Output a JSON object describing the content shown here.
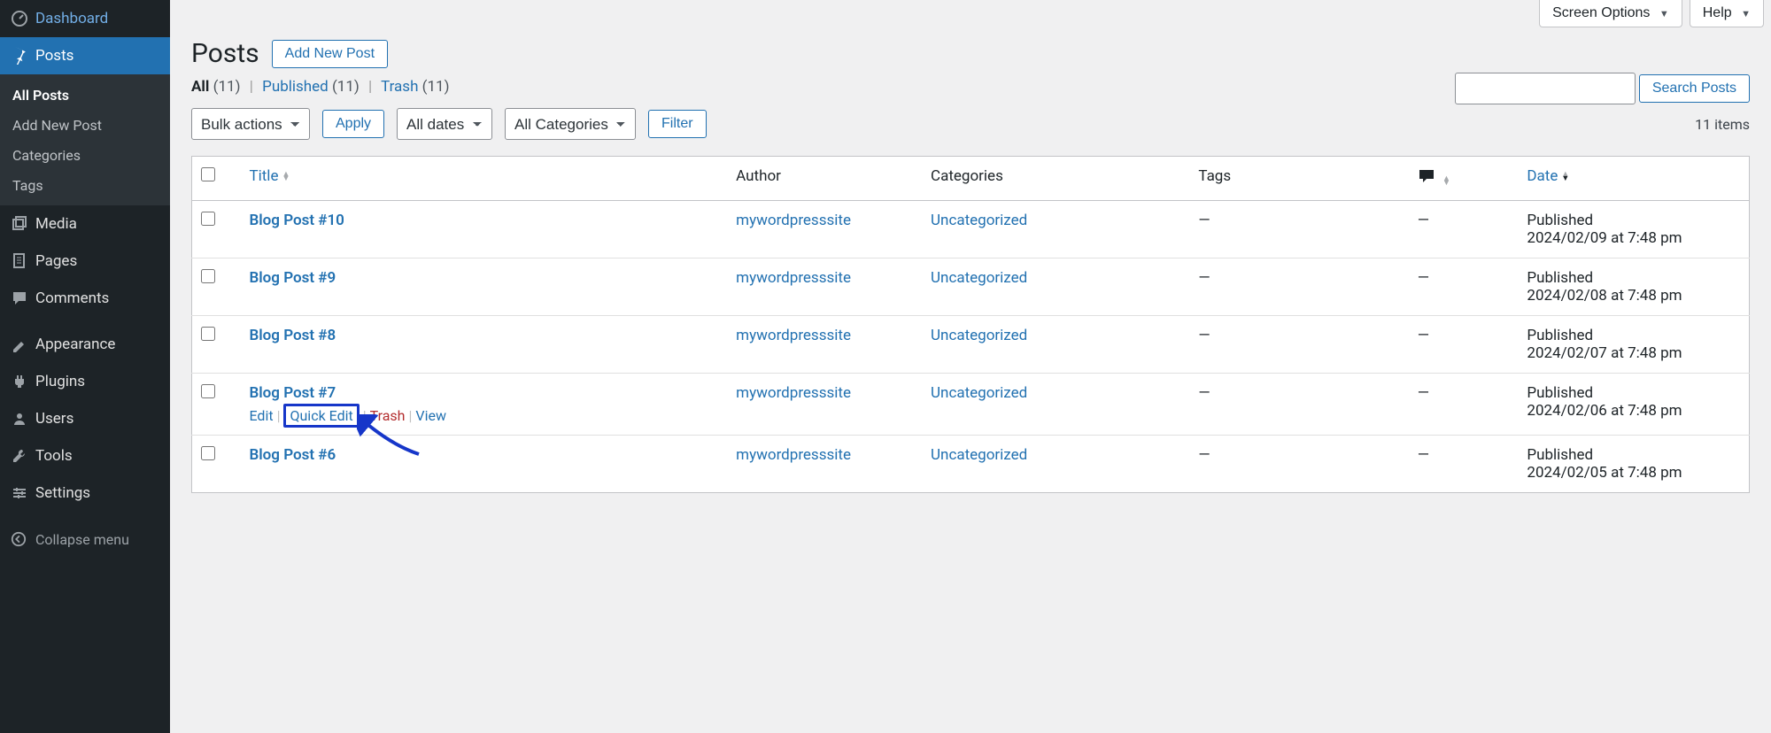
{
  "sidebar": {
    "items": [
      {
        "label": "Dashboard"
      },
      {
        "label": "Posts"
      },
      {
        "label": "Media"
      },
      {
        "label": "Pages"
      },
      {
        "label": "Comments"
      },
      {
        "label": "Appearance"
      },
      {
        "label": "Plugins"
      },
      {
        "label": "Users"
      },
      {
        "label": "Tools"
      },
      {
        "label": "Settings"
      }
    ],
    "posts_submenu": [
      "All Posts",
      "Add New Post",
      "Categories",
      "Tags"
    ],
    "collapse_label": "Collapse menu"
  },
  "topbar": {
    "screen_options": "Screen Options",
    "help": "Help"
  },
  "header": {
    "title": "Posts",
    "add_new": "Add New Post"
  },
  "filters": {
    "all_label": "All",
    "all_count": "(11)",
    "published_label": "Published",
    "published_count": "(11)",
    "trash_label": "Trash",
    "trash_count": "(11)",
    "search_button": "Search Posts",
    "bulk_actions": "Bulk actions",
    "apply": "Apply",
    "all_dates": "All dates",
    "all_categories": "All Categories",
    "filter": "Filter",
    "items_count": "11 items"
  },
  "columns": {
    "title": "Title",
    "author": "Author",
    "categories": "Categories",
    "tags": "Tags",
    "date": "Date"
  },
  "row_actions": {
    "edit": "Edit",
    "quick_edit": "Quick Edit",
    "trash": "Trash",
    "view": "View"
  },
  "posts": [
    {
      "title": "Blog Post #10",
      "author": "mywordpresssite",
      "category": "Uncategorized",
      "tags": "—",
      "comments": "—",
      "date_status": "Published",
      "date_ts": "2024/02/09 at 7:48 pm"
    },
    {
      "title": "Blog Post #9",
      "author": "mywordpresssite",
      "category": "Uncategorized",
      "tags": "—",
      "comments": "—",
      "date_status": "Published",
      "date_ts": "2024/02/08 at 7:48 pm"
    },
    {
      "title": "Blog Post #8",
      "author": "mywordpresssite",
      "category": "Uncategorized",
      "tags": "—",
      "comments": "—",
      "date_status": "Published",
      "date_ts": "2024/02/07 at 7:48 pm"
    },
    {
      "title": "Blog Post #7",
      "author": "mywordpresssite",
      "category": "Uncategorized",
      "tags": "—",
      "comments": "—",
      "date_status": "Published",
      "date_ts": "2024/02/06 at 7:48 pm",
      "hovered": true
    },
    {
      "title": "Blog Post #6",
      "author": "mywordpresssite",
      "category": "Uncategorized",
      "tags": "—",
      "comments": "—",
      "date_status": "Published",
      "date_ts": "2024/02/05 at 7:48 pm"
    }
  ]
}
